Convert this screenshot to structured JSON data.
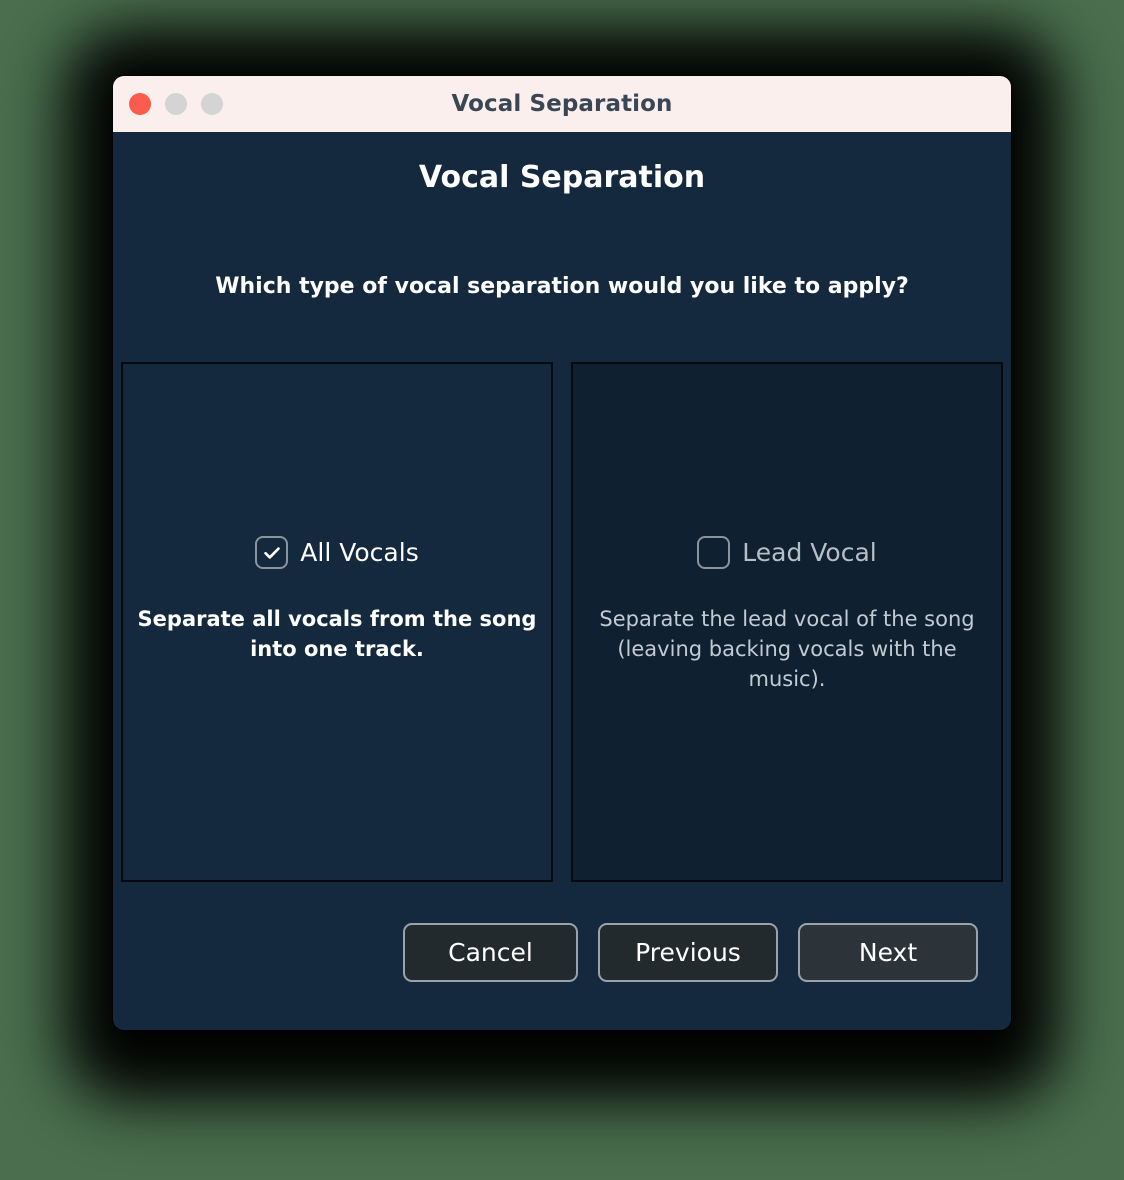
{
  "window": {
    "titlebar_title": "Vocal Separation",
    "traffic_lights": [
      {
        "name": "close-button",
        "color": "#fc5b4e"
      },
      {
        "name": "minimize-button",
        "color": "#d4d4d4"
      },
      {
        "name": "zoom-button",
        "color": "#d4d4d4"
      }
    ]
  },
  "dialog": {
    "title": "Vocal Separation",
    "prompt": "Which type of vocal separation would you like to apply?",
    "options": [
      {
        "id": "all-vocals",
        "label": "All Vocals",
        "checked": true,
        "description": "Separate all vocals from the song into one track."
      },
      {
        "id": "lead-vocal",
        "label": "Lead Vocal",
        "checked": false,
        "description": "Separate the lead vocal of the song (leaving backing vocals with the music)."
      }
    ],
    "buttons": {
      "cancel": "Cancel",
      "previous": "Previous",
      "next": "Next"
    }
  },
  "colors": {
    "desktop_background": "#4a6e4e",
    "titlebar_background": "#faefec",
    "dialog_background": "#14293d",
    "panel_selected_background": "#14293d",
    "panel_unselected_background": "#0f2031",
    "panel_border": "#040a10",
    "button_background": "#232a2e",
    "button_primary_background": "#2c343a",
    "button_border": "#9aa3ab",
    "text_primary": "#ffffff",
    "text_muted": "#c2cbd2",
    "titlebar_text": "#3b4654"
  }
}
